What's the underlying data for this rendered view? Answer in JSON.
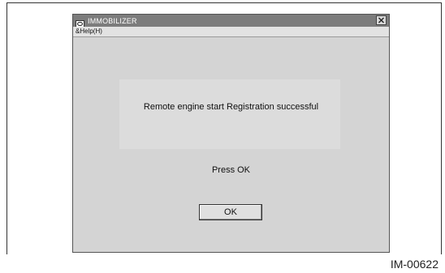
{
  "window": {
    "title": "IMMOBILIZER",
    "icon": "car-key-icon"
  },
  "menu": {
    "items": [
      {
        "label": "&Help(H)"
      }
    ]
  },
  "dialog": {
    "message": "Remote engine start Registration successful",
    "prompt": "Press OK",
    "ok_label": "OK"
  },
  "figure": {
    "id": "IM-00622"
  }
}
